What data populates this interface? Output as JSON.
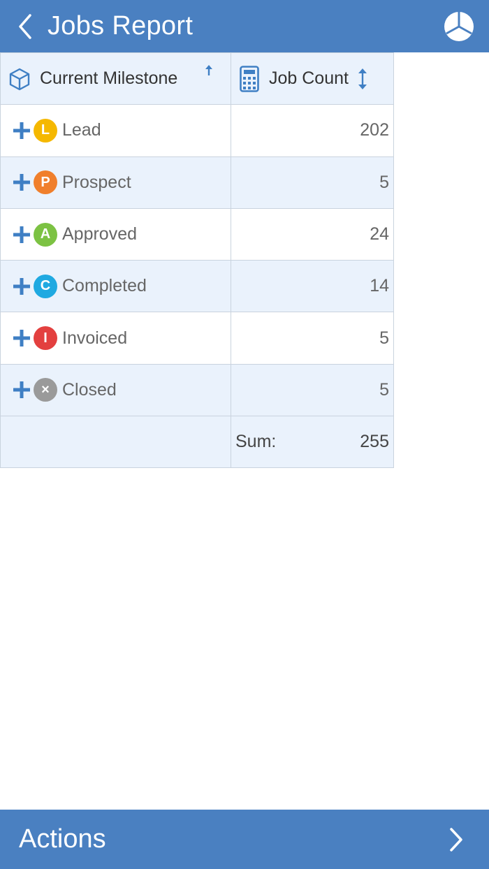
{
  "header": {
    "title": "Jobs Report",
    "back_icon": "chevron-left-icon",
    "chart_icon": "pie-chart-icon"
  },
  "table": {
    "columns": [
      {
        "label": "Current Milestone",
        "icon": "cube-icon",
        "sort": "ascending"
      },
      {
        "label": "Job Count",
        "icon": "calculator-icon",
        "sort": "sortable"
      }
    ],
    "rows": [
      {
        "letter": "L",
        "label": "Lead",
        "count": "202",
        "color": "#f5b800"
      },
      {
        "letter": "P",
        "label": "Prospect",
        "count": "5",
        "color": "#f07f2c"
      },
      {
        "letter": "A",
        "label": "Approved",
        "count": "24",
        "color": "#7cc243"
      },
      {
        "letter": "C",
        "label": "Completed",
        "count": "14",
        "color": "#1fa9e1"
      },
      {
        "letter": "I",
        "label": "Invoiced",
        "count": "5",
        "color": "#e3403f"
      },
      {
        "letter": "×",
        "label": "Closed",
        "count": "5",
        "color": "#9a9a9a"
      }
    ],
    "sum_label": "Sum:",
    "sum_value": "255"
  },
  "footer": {
    "label": "Actions",
    "chevron_icon": "chevron-right-icon"
  },
  "colors": {
    "bar": "#4a80c1",
    "row_alt": "#eaf2fc",
    "plus": "#3f7fc4"
  }
}
